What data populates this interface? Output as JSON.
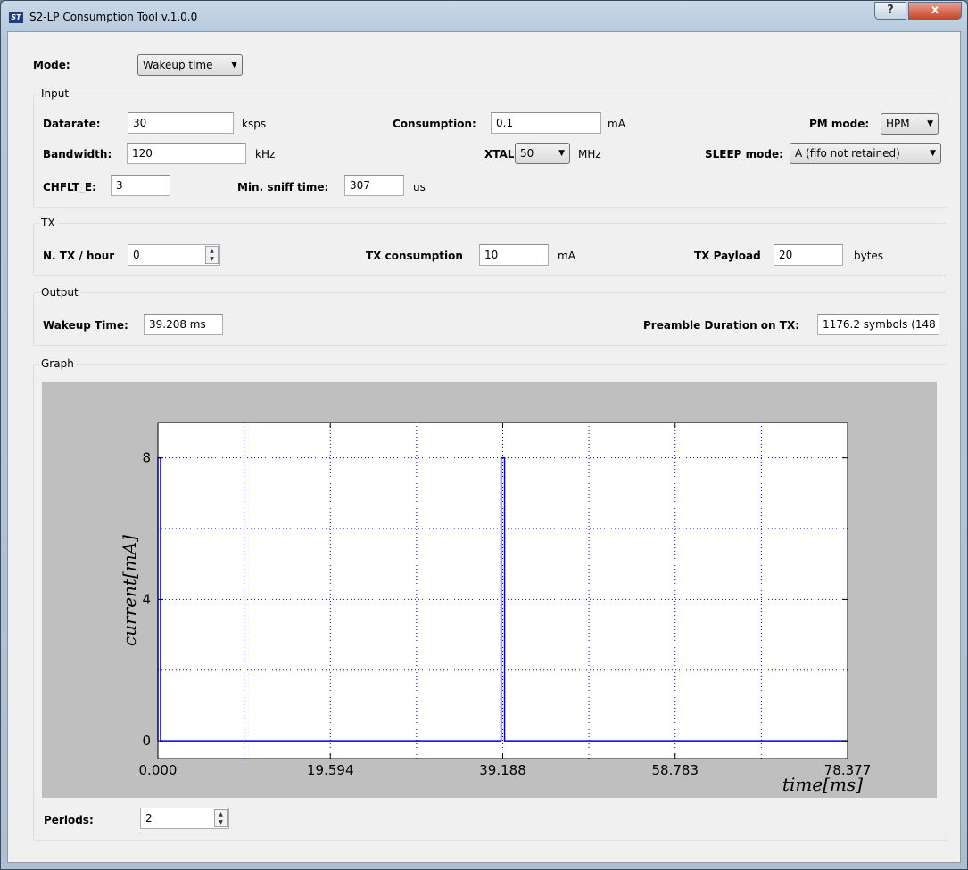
{
  "window": {
    "title": "S2-LP Consumption Tool v.1.0.0",
    "app_icon": "ST",
    "help": "?",
    "close": "x"
  },
  "mode": {
    "label": "Mode:",
    "value": "Wakeup time"
  },
  "input": {
    "title": "Input",
    "datarate": {
      "label": "Datarate:",
      "value": "30",
      "unit": "ksps"
    },
    "bandwidth": {
      "label": "Bandwidth:",
      "value": "120",
      "unit": "kHz"
    },
    "chflt_e": {
      "label": "CHFLT_E:",
      "value": "3"
    },
    "consumption": {
      "label": "Consumption:",
      "value": "0.1",
      "unit": "mA"
    },
    "xtal": {
      "label": "XTAL:",
      "value": "50",
      "unit": "MHz"
    },
    "min_sniff": {
      "label": "Min. sniff time:",
      "value": "307",
      "unit": "us"
    },
    "pm_mode": {
      "label": "PM mode:",
      "value": "HPM"
    },
    "sleep_mode": {
      "label": "SLEEP mode:",
      "value": "A (fifo not retained)"
    }
  },
  "tx": {
    "title": "TX",
    "n_tx": {
      "label": "N. TX / hour",
      "value": "0"
    },
    "tx_consumption": {
      "label": "TX consumption",
      "value": "10",
      "unit": "mA"
    },
    "tx_payload": {
      "label": "TX Payload",
      "value": "20",
      "unit": "bytes"
    }
  },
  "output": {
    "title": "Output",
    "wakeup_time": {
      "label": "Wakeup Time:",
      "value": "39.208 ms"
    },
    "preamble": {
      "label": "Preamble Duration on TX:",
      "value": "1176.2 symbols (148"
    }
  },
  "graph": {
    "title": "Graph",
    "periods_label": "Periods:",
    "periods_value": "2"
  },
  "chart_data": {
    "type": "line",
    "xlabel": "time[ms]",
    "ylabel": "current[mA]",
    "xlim": [
      0,
      78.377
    ],
    "ylim": [
      -0.5,
      9.0
    ],
    "x_ticks": [
      "0.000",
      "19.594",
      "39.188",
      "58.783",
      "78.377"
    ],
    "y_ticks": [
      "0",
      "4",
      "8"
    ],
    "grid": true,
    "color": "#0000ff",
    "series": [
      {
        "x": [
          0,
          0,
          0.3,
          0.3,
          39.0,
          39.0,
          39.4,
          39.4,
          78.377
        ],
        "values": [
          0,
          8,
          8,
          0,
          0,
          8,
          8,
          0,
          0
        ]
      }
    ]
  }
}
